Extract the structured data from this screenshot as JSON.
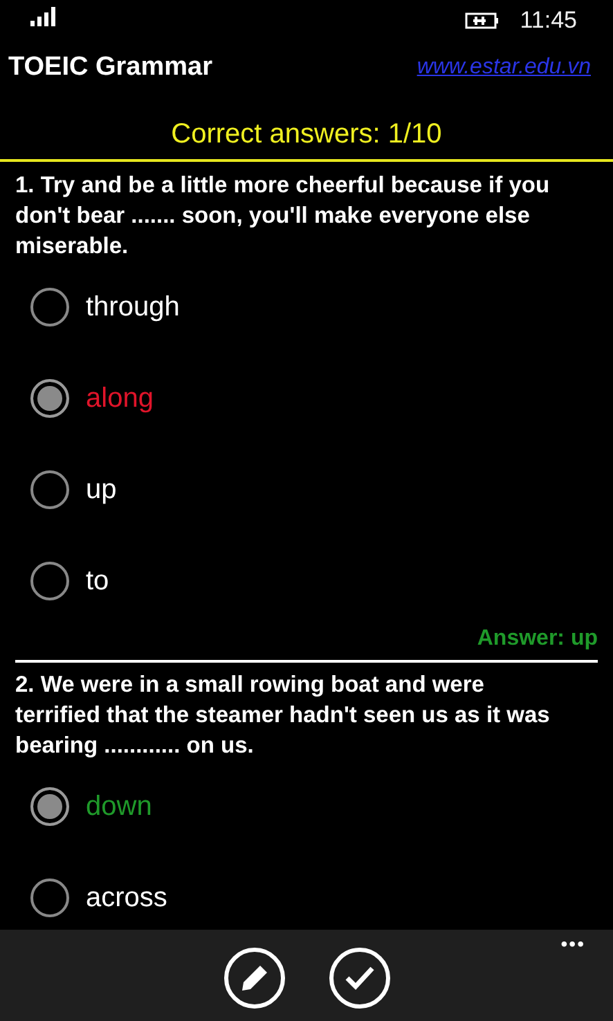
{
  "status_bar": {
    "time": "11:45"
  },
  "header": {
    "title": "TOEIC Grammar",
    "link": "www.estar.edu.vn"
  },
  "score": "Correct answers: 1/10",
  "questions": [
    {
      "text": "1. Try and be a little more cheerful because if you don't bear ....... soon, you'll make everyone else miserable.",
      "correct": false,
      "answer": "Answer: up",
      "options": [
        {
          "label": "through",
          "selected": false
        },
        {
          "label": "along",
          "selected": true
        },
        {
          "label": "up",
          "selected": false
        },
        {
          "label": "to",
          "selected": false
        }
      ]
    },
    {
      "text": "2. We were in a small rowing boat and were terrified that the steamer hadn't seen us as it was bearing ............ on us.",
      "correct": true,
      "options": [
        {
          "label": "down",
          "selected": true
        },
        {
          "label": "across",
          "selected": false
        }
      ]
    }
  ],
  "app_bar": {
    "buttons": [
      {
        "kind": "edit"
      },
      {
        "kind": "check"
      }
    ],
    "more": "•••"
  }
}
